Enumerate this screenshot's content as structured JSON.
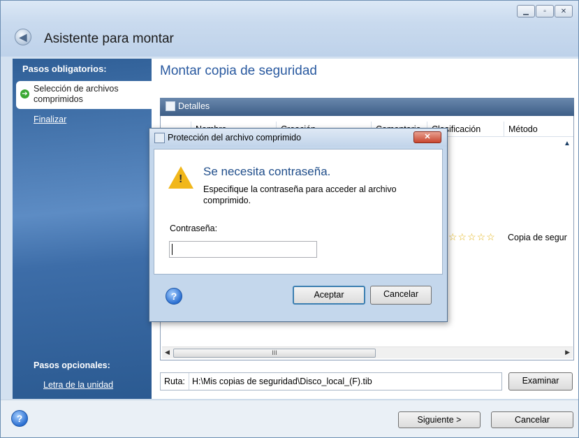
{
  "window": {
    "title": "Asistente para montar",
    "controls": [
      "minimize",
      "maximize",
      "close"
    ]
  },
  "sidebar": {
    "required_heading": "Pasos obligatorios:",
    "items": [
      {
        "label": "Selección de archivos comprimidos",
        "active": true
      },
      {
        "label": "Finalizar",
        "active": false
      }
    ],
    "optional_heading": "Pasos opcionales:",
    "optional_items": [
      {
        "label": "Letra de la unidad"
      }
    ]
  },
  "main": {
    "title": "Montar copia de seguridad",
    "details_label": "Detalles",
    "columns": [
      "Nombre",
      "Creación",
      "Comentario",
      "Clasificación",
      "Método"
    ],
    "row": {
      "rating_stars": 5,
      "rating_filled": 0,
      "method": "Copia de segur"
    },
    "path_label": "Ruta:",
    "path_value": "H:\\Mis copias de seguridad\\Disco_local_(F).tib",
    "browse_button": "Examinar"
  },
  "footer": {
    "next_button": "Siguiente >",
    "cancel_button": "Cancelar"
  },
  "dialog": {
    "title": "Protección del archivo comprimido",
    "heading": "Se necesita contraseña.",
    "message": "Especifique la contraseña para acceder al archivo comprimido.",
    "password_label": "Contraseña:",
    "password_value": "",
    "ok_button": "Aceptar",
    "cancel_button": "Cancelar"
  },
  "icons": {
    "back": "back-arrow-icon",
    "details": "magnifier-icon",
    "warning": "warning-icon",
    "help": "help-icon",
    "active_step": "green-arrow-icon"
  },
  "colors": {
    "sidebar": "#3d6da8",
    "title_blue": "#2a5aa0",
    "warning": "#f1b71b",
    "close_red": "#c9462f"
  }
}
